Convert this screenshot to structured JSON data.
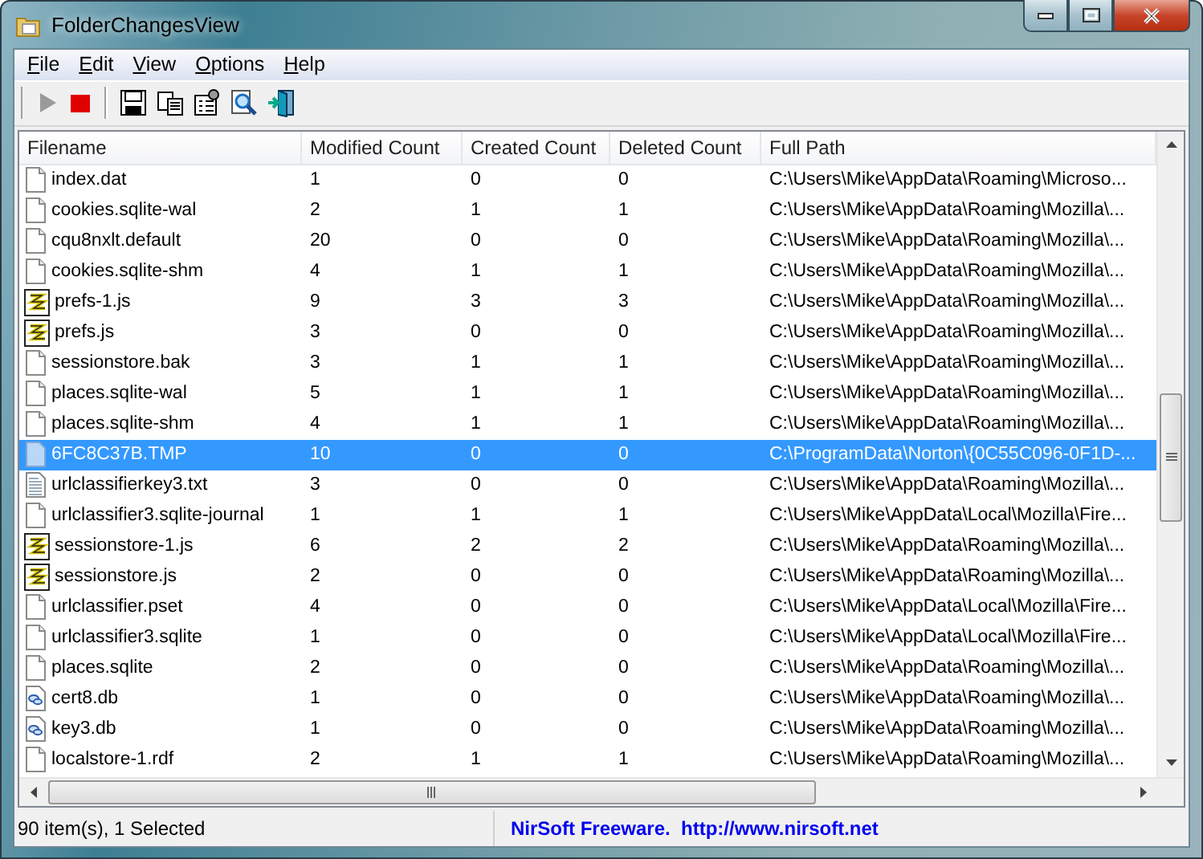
{
  "window": {
    "title": "FolderChangesView"
  },
  "menu": [
    "File",
    "Edit",
    "View",
    "Options",
    "Help"
  ],
  "toolbar": [
    {
      "kind": "play",
      "disabled": true
    },
    {
      "kind": "stop",
      "disabled": false
    },
    {
      "kind": "separator"
    },
    {
      "kind": "save",
      "disabled": false
    },
    {
      "kind": "copy",
      "disabled": false
    },
    {
      "kind": "properties",
      "disabled": false
    },
    {
      "kind": "find",
      "disabled": false
    },
    {
      "kind": "exit",
      "disabled": false
    }
  ],
  "table": {
    "columns": [
      "Filename",
      "Modified Count",
      "Created Count",
      "Deleted Count",
      "Full Path"
    ],
    "rows": [
      {
        "kind": "blank",
        "selected": false,
        "cells": [
          "index.dat",
          "1",
          "0",
          "0",
          "C:\\Users\\Mike\\AppData\\Roaming\\Microso..."
        ]
      },
      {
        "kind": "blank",
        "selected": false,
        "cells": [
          "cookies.sqlite-wal",
          "2",
          "1",
          "1",
          "C:\\Users\\Mike\\AppData\\Roaming\\Mozilla\\..."
        ]
      },
      {
        "kind": "blank",
        "selected": false,
        "cells": [
          "cqu8nxlt.default",
          "20",
          "0",
          "0",
          "C:\\Users\\Mike\\AppData\\Roaming\\Mozilla\\..."
        ]
      },
      {
        "kind": "blank",
        "selected": false,
        "cells": [
          "cookies.sqlite-shm",
          "4",
          "1",
          "1",
          "C:\\Users\\Mike\\AppData\\Roaming\\Mozilla\\..."
        ]
      },
      {
        "kind": "script",
        "selected": false,
        "cells": [
          "prefs-1.js",
          "9",
          "3",
          "3",
          "C:\\Users\\Mike\\AppData\\Roaming\\Mozilla\\..."
        ]
      },
      {
        "kind": "script",
        "selected": false,
        "cells": [
          "prefs.js",
          "3",
          "0",
          "0",
          "C:\\Users\\Mike\\AppData\\Roaming\\Mozilla\\..."
        ]
      },
      {
        "kind": "blank",
        "selected": false,
        "cells": [
          "sessionstore.bak",
          "3",
          "1",
          "1",
          "C:\\Users\\Mike\\AppData\\Roaming\\Mozilla\\..."
        ]
      },
      {
        "kind": "blank",
        "selected": false,
        "cells": [
          "places.sqlite-wal",
          "5",
          "1",
          "1",
          "C:\\Users\\Mike\\AppData\\Roaming\\Mozilla\\..."
        ]
      },
      {
        "kind": "blank",
        "selected": false,
        "cells": [
          "places.sqlite-shm",
          "4",
          "1",
          "1",
          "C:\\Users\\Mike\\AppData\\Roaming\\Mozilla\\..."
        ]
      },
      {
        "kind": "tmp",
        "selected": true,
        "cells": [
          "6FC8C37B.TMP",
          "10",
          "0",
          "0",
          "C:\\ProgramData\\Norton\\{0C55C096-0F1D-..."
        ]
      },
      {
        "kind": "text",
        "selected": false,
        "cells": [
          "urlclassifierkey3.txt",
          "3",
          "0",
          "0",
          "C:\\Users\\Mike\\AppData\\Roaming\\Mozilla\\..."
        ]
      },
      {
        "kind": "blank",
        "selected": false,
        "cells": [
          "urlclassifier3.sqlite-journal",
          "1",
          "1",
          "1",
          "C:\\Users\\Mike\\AppData\\Local\\Mozilla\\Fire..."
        ]
      },
      {
        "kind": "script",
        "selected": false,
        "cells": [
          "sessionstore-1.js",
          "6",
          "2",
          "2",
          "C:\\Users\\Mike\\AppData\\Roaming\\Mozilla\\..."
        ]
      },
      {
        "kind": "script",
        "selected": false,
        "cells": [
          "sessionstore.js",
          "2",
          "0",
          "0",
          "C:\\Users\\Mike\\AppData\\Roaming\\Mozilla\\..."
        ]
      },
      {
        "kind": "blank",
        "selected": false,
        "cells": [
          "urlclassifier.pset",
          "4",
          "0",
          "0",
          "C:\\Users\\Mike\\AppData\\Local\\Mozilla\\Fire..."
        ]
      },
      {
        "kind": "blank",
        "selected": false,
        "cells": [
          "urlclassifier3.sqlite",
          "1",
          "0",
          "0",
          "C:\\Users\\Mike\\AppData\\Local\\Mozilla\\Fire..."
        ]
      },
      {
        "kind": "blank",
        "selected": false,
        "cells": [
          "places.sqlite",
          "2",
          "0",
          "0",
          "C:\\Users\\Mike\\AppData\\Roaming\\Mozilla\\..."
        ]
      },
      {
        "kind": "db",
        "selected": false,
        "cells": [
          "cert8.db",
          "1",
          "0",
          "0",
          "C:\\Users\\Mike\\AppData\\Roaming\\Mozilla\\..."
        ]
      },
      {
        "kind": "db",
        "selected": false,
        "cells": [
          "key3.db",
          "1",
          "0",
          "0",
          "C:\\Users\\Mike\\AppData\\Roaming\\Mozilla\\..."
        ]
      },
      {
        "kind": "blank",
        "selected": false,
        "cells": [
          "localstore-1.rdf",
          "2",
          "1",
          "1",
          "C:\\Users\\Mike\\AppData\\Roaming\\Mozilla\\..."
        ]
      }
    ]
  },
  "status_bar": {
    "items": "90 item(s), 1 Selected",
    "credit": "NirSoft Freeware.  http://www.nirsoft.net"
  }
}
